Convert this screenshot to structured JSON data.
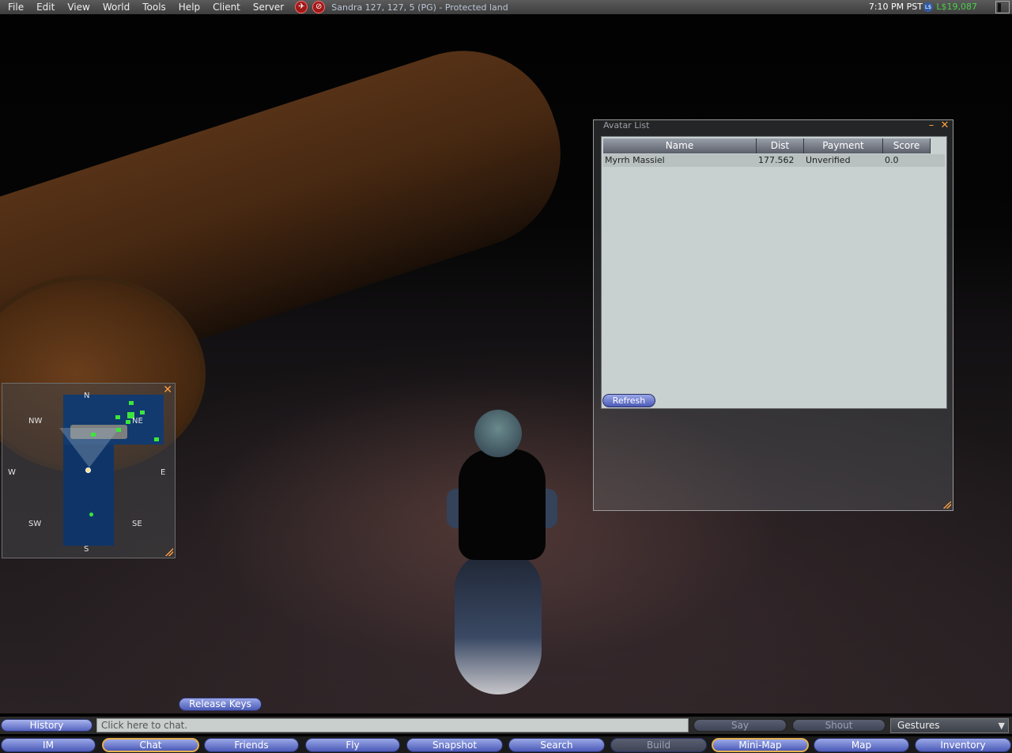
{
  "menubar": {
    "menus": [
      "File",
      "Edit",
      "View",
      "World",
      "Tools",
      "Help",
      "Client",
      "Server"
    ],
    "location": "Sandra 127, 127, 5 (PG) - Protected land",
    "clock": "7:10 PM PST",
    "currency_icon": "L$",
    "balance": "L$19,087"
  },
  "avatar_list": {
    "title": "Avatar List",
    "columns": [
      "Name",
      "Dist",
      "Payment",
      "Score"
    ],
    "rows": [
      {
        "name": "Myrrh Massiel",
        "dist": "177.562",
        "payment": "Unverified",
        "score": "0.0"
      }
    ],
    "refresh_label": "Refresh"
  },
  "minimap": {
    "labels": {
      "n": "N",
      "ne": "NE",
      "nw": "NW",
      "w": "W",
      "e": "E",
      "sw": "SW",
      "se": "SE",
      "s": "S"
    }
  },
  "release_keys_label": "Release Keys",
  "chat": {
    "history_label": "History",
    "placeholder": "Click here to chat.",
    "say_label": "Say",
    "shout_label": "Shout",
    "gestures_label": "Gestures"
  },
  "toolbar": {
    "buttons": [
      "IM",
      "Chat",
      "Friends",
      "Fly",
      "Snapshot",
      "Search",
      "Build",
      "Mini-Map",
      "Map",
      "Inventory"
    ]
  },
  "colors": {
    "accent": "#ffa040",
    "balance": "#4cd04c",
    "button": "#5564c0"
  }
}
